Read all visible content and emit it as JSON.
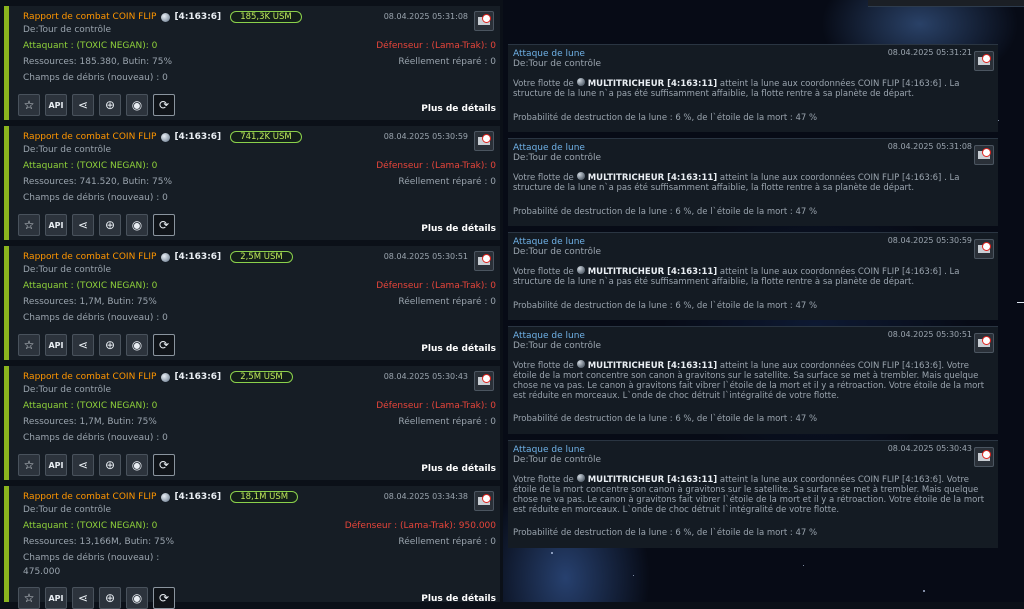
{
  "combat_reports": [
    {
      "title": "Rapport de combat COIN FLIP",
      "coords": "[4:163:6]",
      "usm": "185,3K USM",
      "date": "08.04.2025 05:31:08",
      "from": "De:Tour de contrôle",
      "attacker": "Attaquant : (TOXIC NEGAN): 0",
      "defender": "Défenseur : (Lama-Trak): 0",
      "resources": "Ressources: 185.380, Butin: 75%",
      "repaired": "Réellement réparé : 0",
      "debris": "Champs de débris (nouveau) : 0",
      "debris_value": "",
      "details": "Plus de détails"
    },
    {
      "title": "Rapport de combat COIN FLIP",
      "coords": "[4:163:6]",
      "usm": "741,2K USM",
      "date": "08.04.2025 05:30:59",
      "from": "De:Tour de contrôle",
      "attacker": "Attaquant : (TOXIC NEGAN): 0",
      "defender": "Défenseur : (Lama-Trak): 0",
      "resources": "Ressources: 741.520, Butin: 75%",
      "repaired": "Réellement réparé : 0",
      "debris": "Champs de débris (nouveau) : 0",
      "debris_value": "",
      "details": "Plus de détails"
    },
    {
      "title": "Rapport de combat COIN FLIP",
      "coords": "[4:163:6]",
      "usm": "2,5M USM",
      "date": "08.04.2025 05:30:51",
      "from": "De:Tour de contrôle",
      "attacker": "Attaquant : (TOXIC NEGAN): 0",
      "defender": "Défenseur : (Lama-Trak): 0",
      "resources": "Ressources: 1,7M, Butin: 75%",
      "repaired": "Réellement réparé : 0",
      "debris": "Champs de débris (nouveau) : 0",
      "debris_value": "",
      "details": "Plus de détails"
    },
    {
      "title": "Rapport de combat COIN FLIP",
      "coords": "[4:163:6]",
      "usm": "2,5M USM",
      "date": "08.04.2025 05:30:43",
      "from": "De:Tour de contrôle",
      "attacker": "Attaquant : (TOXIC NEGAN): 0",
      "defender": "Défenseur : (Lama-Trak): 0",
      "resources": "Ressources: 1,7M, Butin: 75%",
      "repaired": "Réellement réparé : 0",
      "debris": "Champs de débris (nouveau) : 0",
      "debris_value": "",
      "details": "Plus de détails"
    },
    {
      "title": "Rapport de combat COIN FLIP",
      "coords": "[4:163:6]",
      "usm": "18,1M USM",
      "date": "08.04.2025 03:34:38",
      "from": "De:Tour de contrôle",
      "attacker": "Attaquant : (TOXIC NEGAN): 0",
      "defender": "Défenseur : (Lama-Trak): 950.000",
      "resources": "Ressources: 13,166M, Butin: 75%",
      "repaired": "Réellement réparé : 0",
      "debris": "Champs de débris (nouveau) :",
      "debris_value": "475.000",
      "details": "Plus de détails"
    }
  ],
  "report_icons": {
    "api_label": "API",
    "icon_names": [
      "star-icon",
      "api-icon",
      "share-icon",
      "target-icon",
      "eye-icon",
      "spy-icon"
    ]
  },
  "moon_attacks": [
    {
      "title": "Attaque de lune",
      "from": "De:Tour de contrôle",
      "date": "08.04.2025 05:31:21",
      "prefix": "Votre flotte de",
      "player": "MULTITRICHEUR [4:163:11]",
      "body": "atteint la lune aux coordonnées COIN FLIP [4:163:6] . La structure de la lune n`a pas été suffisamment affaiblie, la flotte rentre à sa planète de départ.",
      "probability": "Probabilité de destruction de la lune : 6 %, de l`étoile de la mort : 47 %"
    },
    {
      "title": "Attaque de lune",
      "from": "De:Tour de contrôle",
      "date": "08.04.2025 05:31:08",
      "prefix": "Votre flotte de",
      "player": "MULTITRICHEUR [4:163:11]",
      "body": "atteint la lune aux coordonnées COIN FLIP [4:163:6] . La structure de la lune n`a pas été suffisamment affaiblie, la flotte rentre à sa planète de départ.",
      "probability": "Probabilité de destruction de la lune : 6 %, de l`étoile de la mort : 47 %"
    },
    {
      "title": "Attaque de lune",
      "from": "De:Tour de contrôle",
      "date": "08.04.2025 05:30:59",
      "prefix": "Votre flotte de",
      "player": "MULTITRICHEUR [4:163:11]",
      "body": "atteint la lune aux coordonnées COIN FLIP [4:163:6] . La structure de la lune n`a pas été suffisamment affaiblie, la flotte rentre à sa planète de départ.",
      "probability": "Probabilité de destruction de la lune : 6 %, de l`étoile de la mort : 47 %"
    },
    {
      "title": "Attaque de lune",
      "from": "De:Tour de contrôle",
      "date": "08.04.2025 05:30:51",
      "prefix": "Votre flotte de",
      "player": "MULTITRICHEUR [4:163:11]",
      "body": "atteint la lune aux coordonnées COIN FLIP [4:163:6]. Votre étoile de la mort concentre son canon à gravitons sur le satellite. Sa surface se met à trembler. Mais quelque chose ne va pas. Le canon à gravitons fait vibrer l`étoile de la mort et il y a rétroaction. Votre étoile de la mort est réduite en morceaux. L`onde de choc détruit l`intégralité de votre flotte.",
      "probability": "Probabilité de destruction de la lune : 6 %, de l`étoile de la mort : 47 %"
    },
    {
      "title": "Attaque de lune",
      "from": "De:Tour de contrôle",
      "date": "08.04.2025 05:30:43",
      "prefix": "Votre flotte de",
      "player": "MULTITRICHEUR [4:163:11]",
      "body": "atteint la lune aux coordonnées COIN FLIP [4:163:6]. Votre étoile de la mort concentre son canon à gravitons sur le satellite. Sa surface se met à trembler. Mais quelque chose ne va pas. Le canon à gravitons fait vibrer l`étoile de la mort et il y a rétroaction. Votre étoile de la mort est réduite en morceaux. L`onde de choc détruit l`intégralité de votre flotte.",
      "probability": "Probabilité de destruction de la lune : 6 %, de l`étoile de la mort : 47 %"
    }
  ],
  "colors": {
    "accent_green": "#8ab31e",
    "title_orange": "#ff9600",
    "defender_red": "#e7453a",
    "link_blue": "#6fb1e6"
  }
}
